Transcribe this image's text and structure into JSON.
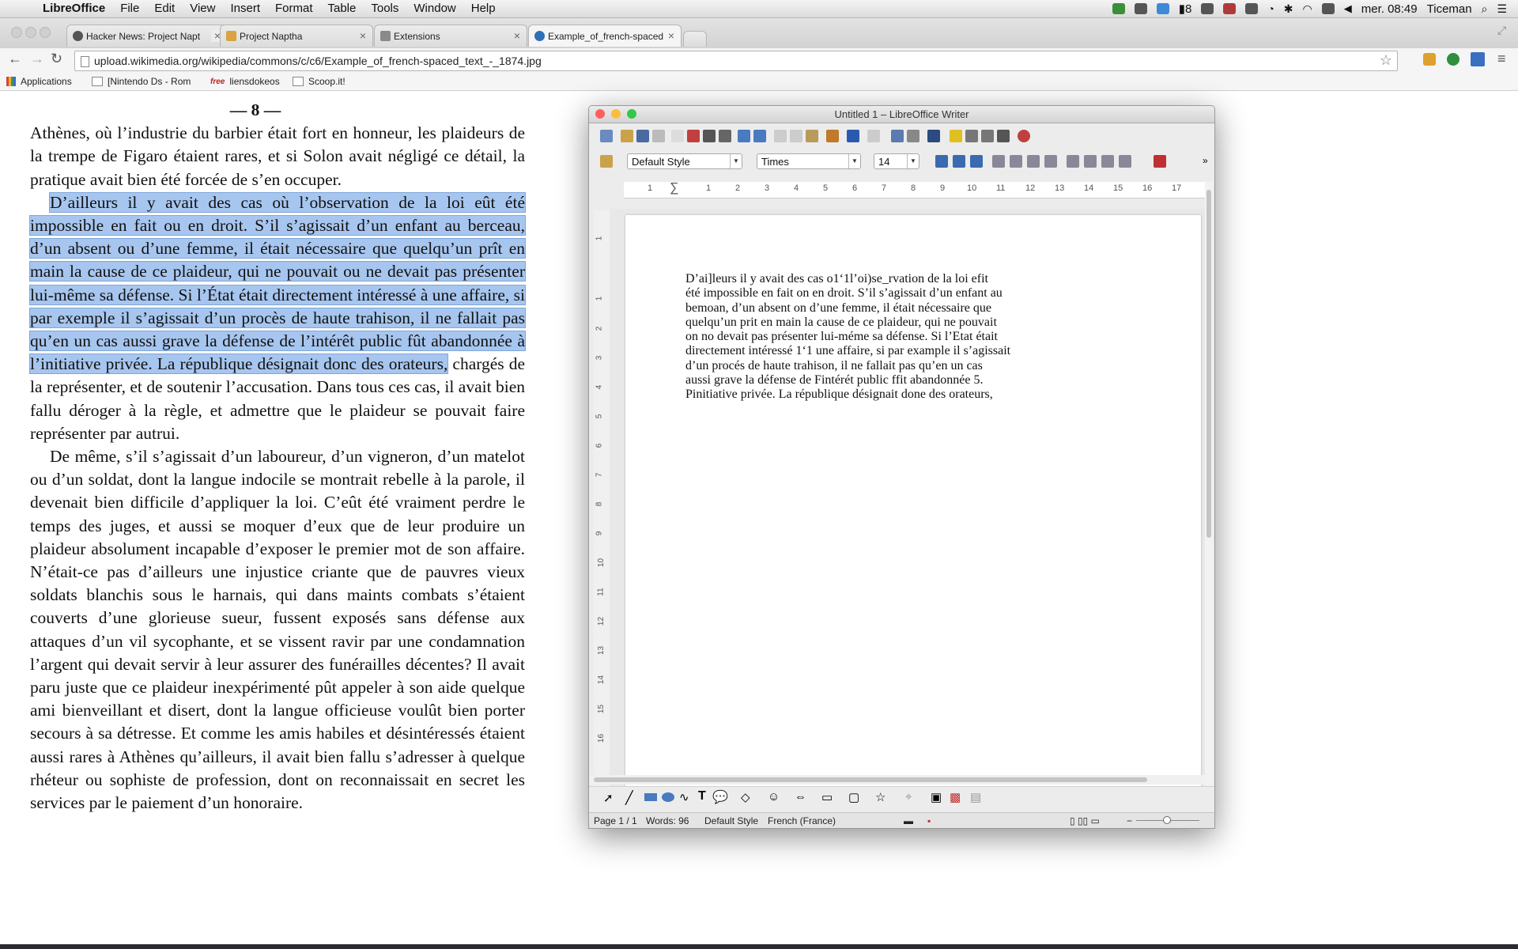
{
  "menubar": {
    "app": "LibreOffice",
    "items": [
      "File",
      "Edit",
      "View",
      "Insert",
      "Format",
      "Table",
      "Tools",
      "Window",
      "Help"
    ],
    "status_count": "8",
    "clock": "mer. 08:49",
    "user": "Ticeman"
  },
  "browser": {
    "tabs": [
      {
        "title": "Hacker News: Project Napt"
      },
      {
        "title": "Project Naptha"
      },
      {
        "title": "Extensions"
      },
      {
        "title": "Example_of_french-spaced"
      }
    ],
    "url": "upload.wikimedia.org/wikipedia/commons/c/c6/Example_of_french-spaced_text_-_1874.jpg",
    "bookmarks": [
      "Applications",
      "[Nintendo Ds - Rom",
      "liensdokeos",
      "Scoop.it!"
    ]
  },
  "scan": {
    "page_number": "— 8 —",
    "para1": "Athènes, où l’industrie du barbier était fort en honneur, les plaideurs de la trempe de Figaro étaient rares, et si Solon avait négligé ce détail, la pratique avait bien été forcée de s’en occuper.",
    "para2_selected": "D’ailleurs il y avait des cas où l’observation de la loi eût été impossible en fait ou en droit. S’il s’agissait d’un enfant au berceau, d’un absent ou d’une femme, il était nécessaire que quelqu’un prît en main la cause de ce plaideur, qui ne pouvait ou ne devait pas présenter lui-même sa défense. Si l’État était directement intéressé à une affaire, si par exemple il s’agissait d’un procès de haute trahison, il ne fallait pas qu’en un cas aussi grave la défense de l’intérêt public fût abandonnée à l’initiative privée. La république désignait donc des orateurs,",
    "para2_rest": "chargés de la représenter, et de soutenir l’accusation. Dans tous ces cas, il avait bien fallu déroger à la règle, et admettre que le plaideur se pouvait faire représenter par autrui.",
    "para3": "De même, s’il s’agissait d’un laboureur, d’un vigneron, d’un matelot ou d’un soldat, dont la langue indocile se montrait rebelle à la parole, il devenait bien difficile d’appliquer la loi. C’eût été vraiment perdre le temps des juges, et aussi se moquer d’eux que de leur produire un plaideur absolument incapable d’exposer le premier mot de son affaire. N’était-ce pas d’ailleurs une injustice criante que de pauvres vieux soldats blanchis sous le harnais, qui dans maints combats s’étaient couverts d’une glorieuse sueur, fussent exposés sans défense aux attaques d’un vil sycophante, et se vissent ravir par une condamnation l’argent qui devait servir à leur assurer des funérailles décentes? Il avait paru juste que ce plaideur inexpérimenté pût appeler à son aide quelque ami bienveillant et disert, dont la langue officieuse voulût bien porter secours à sa détresse. Et comme les amis habiles et désintéressés étaient aussi rares à Athènes qu’ailleurs, il avait bien fallu s’adresser à quelque rhéteur ou sophiste de profession, dont on reconnaissait en secret les services par le paiement d’un honoraire."
  },
  "writer": {
    "title": "Untitled 1 – LibreOffice Writer",
    "style": "Default Style",
    "font": "Times",
    "size": "14",
    "ruler_ticks": [
      "1",
      "1",
      "2",
      "3",
      "4",
      "5",
      "6",
      "7",
      "8",
      "9",
      "10",
      "11",
      "12",
      "13",
      "14",
      "15",
      "16",
      "17"
    ],
    "vruler_ticks": [
      "1",
      "1",
      "2",
      "3",
      "4",
      "5",
      "6",
      "7",
      "8",
      "9",
      "10",
      "11",
      "12",
      "13",
      "14",
      "15",
      "16"
    ],
    "doc_lines": [
      "D’ai]leurs il y avait des cas o1‘1l’oi)se_rvation de la loi efit",
      "été impossible en fait on en droit. S’il s’agissait d’un enfant au",
      "bemoan, d’un absent on d’une femme, il était nécessaire que",
      "quelqu’un prit en main la cause de ce plaideur, qui ne pouvait",
      "on no devait pas présenter lui-méme sa défense. Si l’Etat était",
      "directement intéressé 1‘1 une affaire, si par example il s’agissait",
      "d’un procés de haute trahison, il ne fallait pas qu’en un cas",
      "aussi grave la défense de Fintérét public ffit abandonnée 5.",
      "Pinitiative privée. La république désignait done des orateurs,"
    ],
    "status": {
      "page": "Page 1 / 1",
      "words": "Words: 96",
      "style": "Default Style",
      "language": "French (France)"
    }
  },
  "colors": {
    "selection": "#a7c6ef",
    "close": "#fc605b",
    "minimize": "#fdbc40",
    "zoom": "#34c84a"
  },
  "icons": [
    "apple-icon",
    "wifi-icon",
    "bluetooth-icon",
    "search-icon",
    "star-icon",
    "reload-icon",
    "back-icon",
    "forward-icon",
    "menu-icon"
  ]
}
